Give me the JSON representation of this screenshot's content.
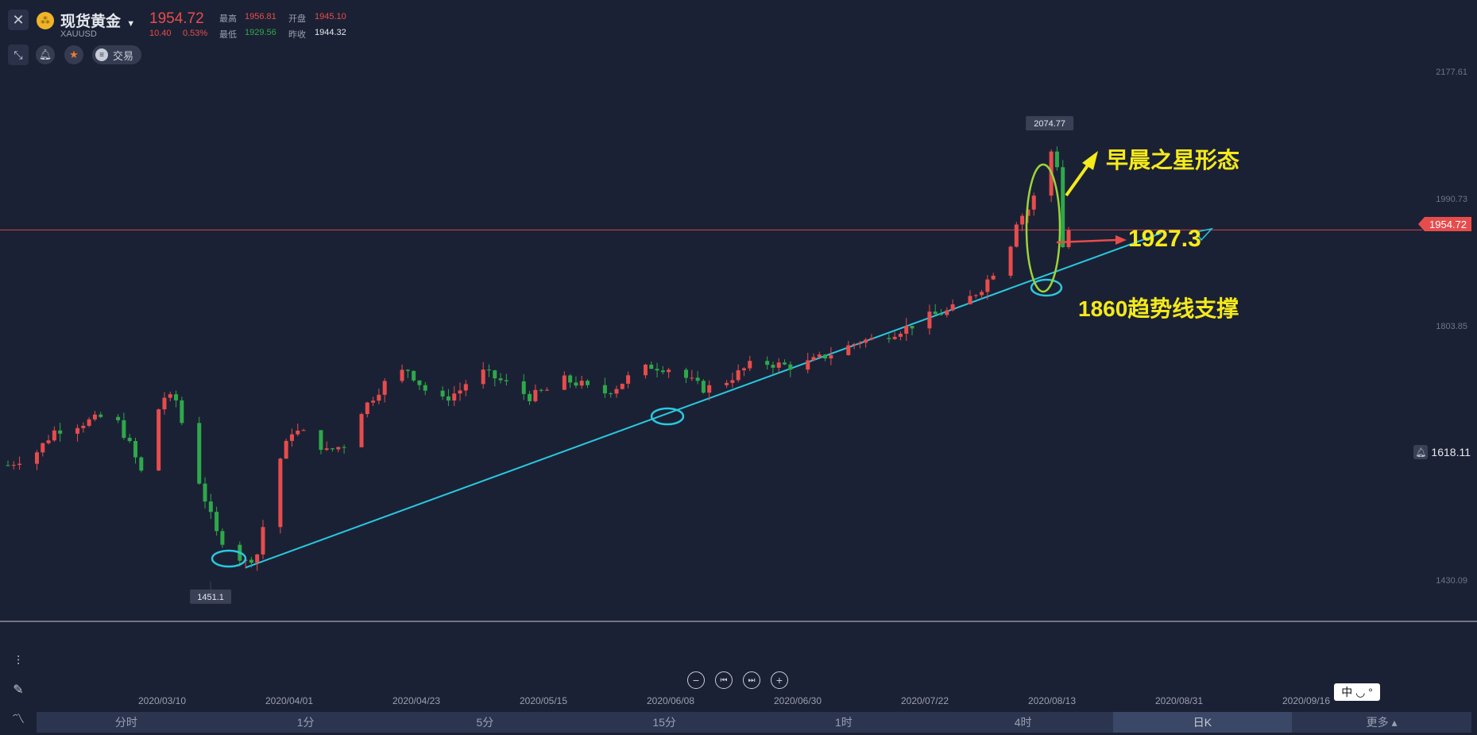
{
  "header": {
    "close_icon": "close-icon",
    "symbol_name": "现货黄金",
    "symbol_code": "XAUUSD",
    "last_price": "1954.72",
    "change": "10.40",
    "change_pct": "0.53%",
    "high_label": "最高",
    "high_value": "1956.81",
    "open_label": "开盘",
    "open_value": "1945.10",
    "low_label": "最低",
    "low_value": "1929.56",
    "prev_close_label": "昨收",
    "prev_close_value": "1944.32",
    "trade_label": "交易",
    "colors": {
      "up": "#e74c4c",
      "down": "#2ea84a",
      "accent": "#f0b429"
    }
  },
  "price_axis": {
    "labels": [
      "2177.61",
      "1990.73",
      "1803.85",
      "1430.09"
    ],
    "current_price_tag": "1954.72",
    "alert_price": "1618.11"
  },
  "chart_data": {
    "type": "candlestick",
    "x_range": [
      "2020/02/19",
      "2020/08/20"
    ],
    "ylim": [
      1380,
      2210
    ],
    "x_ticks": [
      "2020/03/10",
      "2020/04/01",
      "2020/04/23",
      "2020/05/15",
      "2020/06/08",
      "2020/06/30",
      "2020/07/22",
      "2020/08/13",
      "2020/08/31",
      "2020/09/16"
    ],
    "marked_low": "1451.1",
    "marked_high": "2074.77",
    "current_price": 1954.72,
    "colors": {
      "up": "#e74c4c",
      "down": "#2ea84a"
    },
    "close_path": [
      [
        "2020/02/19",
        1610
      ],
      [
        "2020/02/24",
        1630
      ],
      [
        "2020/02/27",
        1660
      ],
      [
        "2020/03/03",
        1672
      ],
      [
        "2020/03/06",
        1680
      ],
      [
        "2020/03/09",
        1672
      ],
      [
        "2020/03/11",
        1640
      ],
      [
        "2020/03/13",
        1600
      ],
      [
        "2020/03/15",
        1675
      ],
      [
        "2020/03/17",
        1710
      ],
      [
        "2020/03/19",
        1705
      ],
      [
        "2020/03/21",
        1640
      ],
      [
        "2020/03/24",
        1560
      ],
      [
        "2020/03/26",
        1510
      ],
      [
        "2020/03/29",
        1480
      ],
      [
        "2020/03/31",
        1468
      ],
      [
        "2020/04/02",
        1480
      ],
      [
        "2020/04/04",
        1560
      ],
      [
        "2020/04/06",
        1620
      ],
      [
        "2020/04/08",
        1660
      ],
      [
        "2020/04/11",
        1655
      ],
      [
        "2020/04/14",
        1630
      ],
      [
        "2020/04/17",
        1640
      ],
      [
        "2020/04/20",
        1690
      ],
      [
        "2020/04/22",
        1710
      ],
      [
        "2020/04/25",
        1740
      ],
      [
        "2020/04/28",
        1750
      ],
      [
        "2020/05/01",
        1720
      ],
      [
        "2020/05/04",
        1705
      ],
      [
        "2020/05/07",
        1720
      ],
      [
        "2020/05/10",
        1750
      ],
      [
        "2020/05/13",
        1738
      ],
      [
        "2020/05/16",
        1725
      ],
      [
        "2020/05/19",
        1710
      ],
      [
        "2020/05/22",
        1720
      ],
      [
        "2020/05/25",
        1735
      ],
      [
        "2020/05/28",
        1728
      ],
      [
        "2020/05/31",
        1712
      ],
      [
        "2020/06/03",
        1725
      ],
      [
        "2020/06/06",
        1745
      ],
      [
        "2020/06/09",
        1755
      ],
      [
        "2020/06/12",
        1752
      ],
      [
        "2020/06/15",
        1738
      ],
      [
        "2020/06/18",
        1722
      ],
      [
        "2020/06/21",
        1728
      ],
      [
        "2020/06/24",
        1745
      ],
      [
        "2020/06/27",
        1762
      ],
      [
        "2020/06/30",
        1758
      ],
      [
        "2020/07/03",
        1755
      ],
      [
        "2020/07/06",
        1760
      ],
      [
        "2020/07/09",
        1770
      ],
      [
        "2020/07/12",
        1780
      ],
      [
        "2020/07/15",
        1792
      ],
      [
        "2020/07/18",
        1795
      ],
      [
        "2020/07/21",
        1805
      ],
      [
        "2020/07/24",
        1815
      ],
      [
        "2020/07/27",
        1828
      ],
      [
        "2020/07/30",
        1835
      ],
      [
        "2020/08/02",
        1848
      ],
      [
        "2020/08/05",
        1870
      ],
      [
        "2020/08/08",
        1905
      ],
      [
        "2020/08/10",
        1935
      ],
      [
        "2020/08/11",
        1968
      ],
      [
        "2020/08/13",
        1985
      ],
      [
        "2020/08/15",
        2020
      ],
      [
        "2020/08/16",
        2050
      ],
      [
        "2020/08/17",
        2070
      ],
      [
        "2020/08/18",
        2050
      ],
      [
        "2020/08/19",
        1930
      ],
      [
        "2020/08/20",
        1954
      ]
    ],
    "trend_line": {
      "from": [
        "2020/03/31",
        1460
      ],
      "to": [
        "2020/09/05",
        1950
      ]
    }
  },
  "annotations": {
    "morning_star": "早晨之星形态",
    "level_1927": "1927.3",
    "trend_support": "1860趋势线支撑"
  },
  "navigator": {
    "zoom_out_icon": "minus-icon",
    "prev_icon": "skip-back-icon",
    "next_icon": "skip-forward-icon",
    "zoom_in_icon": "plus-icon"
  },
  "timeframes": [
    "分时",
    "1分",
    "5分",
    "15分",
    "1时",
    "4时",
    "日K",
    "更多 ▴"
  ],
  "active_timeframe": "日K",
  "input_widget": "中 ◡ °"
}
